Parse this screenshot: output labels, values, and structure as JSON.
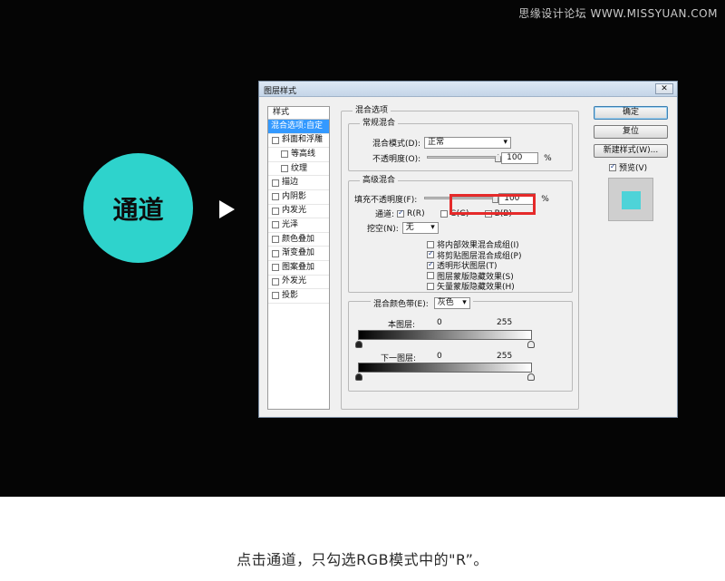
{
  "watermark": "思缘设计论坛 WWW.MISSYUAN.COM",
  "circle_label": "通道",
  "dialog": {
    "title": "图层样式",
    "close_symbol": "✕",
    "sidebar": {
      "header": "样式",
      "items": [
        {
          "label": "混合选项:自定",
          "checkbox": false,
          "selected": true,
          "indent": false
        },
        {
          "label": "斜面和浮雕",
          "checkbox": true,
          "selected": false,
          "indent": false
        },
        {
          "label": "等高线",
          "checkbox": true,
          "selected": false,
          "indent": true
        },
        {
          "label": "纹理",
          "checkbox": true,
          "selected": false,
          "indent": true
        },
        {
          "label": "描边",
          "checkbox": true,
          "selected": false,
          "indent": false
        },
        {
          "label": "内阴影",
          "checkbox": true,
          "selected": false,
          "indent": false
        },
        {
          "label": "内发光",
          "checkbox": true,
          "selected": false,
          "indent": false
        },
        {
          "label": "光泽",
          "checkbox": true,
          "selected": false,
          "indent": false
        },
        {
          "label": "颜色叠加",
          "checkbox": true,
          "selected": false,
          "indent": false
        },
        {
          "label": "渐变叠加",
          "checkbox": true,
          "selected": false,
          "indent": false
        },
        {
          "label": "图案叠加",
          "checkbox": true,
          "selected": false,
          "indent": false
        },
        {
          "label": "外发光",
          "checkbox": true,
          "selected": false,
          "indent": false
        },
        {
          "label": "投影",
          "checkbox": true,
          "selected": false,
          "indent": false
        }
      ]
    },
    "blend_options": {
      "title": "混合选项",
      "general": {
        "title": "常规混合",
        "mode_label": "混合模式(D):",
        "mode_value": "正常",
        "opacity_label": "不透明度(O):",
        "opacity_value": "100",
        "percent": "%"
      },
      "advanced": {
        "title": "高级混合",
        "fill_label": "填充不透明度(F):",
        "fill_value": "100",
        "percent": "%",
        "channels_label": "通道:",
        "channel_r": "R(R)",
        "channel_g": "G(G)",
        "channel_b": "B(B)",
        "channel_r_checked": true,
        "channel_g_checked": false,
        "channel_b_checked": false,
        "knockout_label": "挖空(N):",
        "knockout_value": "无",
        "options": [
          {
            "label": "将内部效果混合成组(I)",
            "checked": false
          },
          {
            "label": "将剪贴图层混合成组(P)",
            "checked": true
          },
          {
            "label": "透明形状图层(T)",
            "checked": true
          },
          {
            "label": "图层蒙版隐藏效果(S)",
            "checked": false
          },
          {
            "label": "矢量蒙版隐藏效果(H)",
            "checked": false
          }
        ]
      },
      "blend_if": {
        "label": "混合颜色带(E):",
        "value": "灰色",
        "this_layer_label": "本图层:",
        "this_layer_min": "0",
        "this_layer_max": "255",
        "underlying_label": "下一图层:",
        "underlying_min": "0",
        "underlying_max": "255"
      }
    },
    "buttons": {
      "ok": "确定",
      "reset": "复位",
      "new_style": "新建样式(W)...",
      "preview_label": "预览(V)",
      "preview_checked": true
    },
    "preview_color": "#4ed3d8"
  },
  "caption": "点击通道，只勾选RGB模式中的\"R”。",
  "colors": {
    "accent": "#2ed3cc",
    "highlight": "#e52a2a",
    "selection": "#3399ff"
  }
}
